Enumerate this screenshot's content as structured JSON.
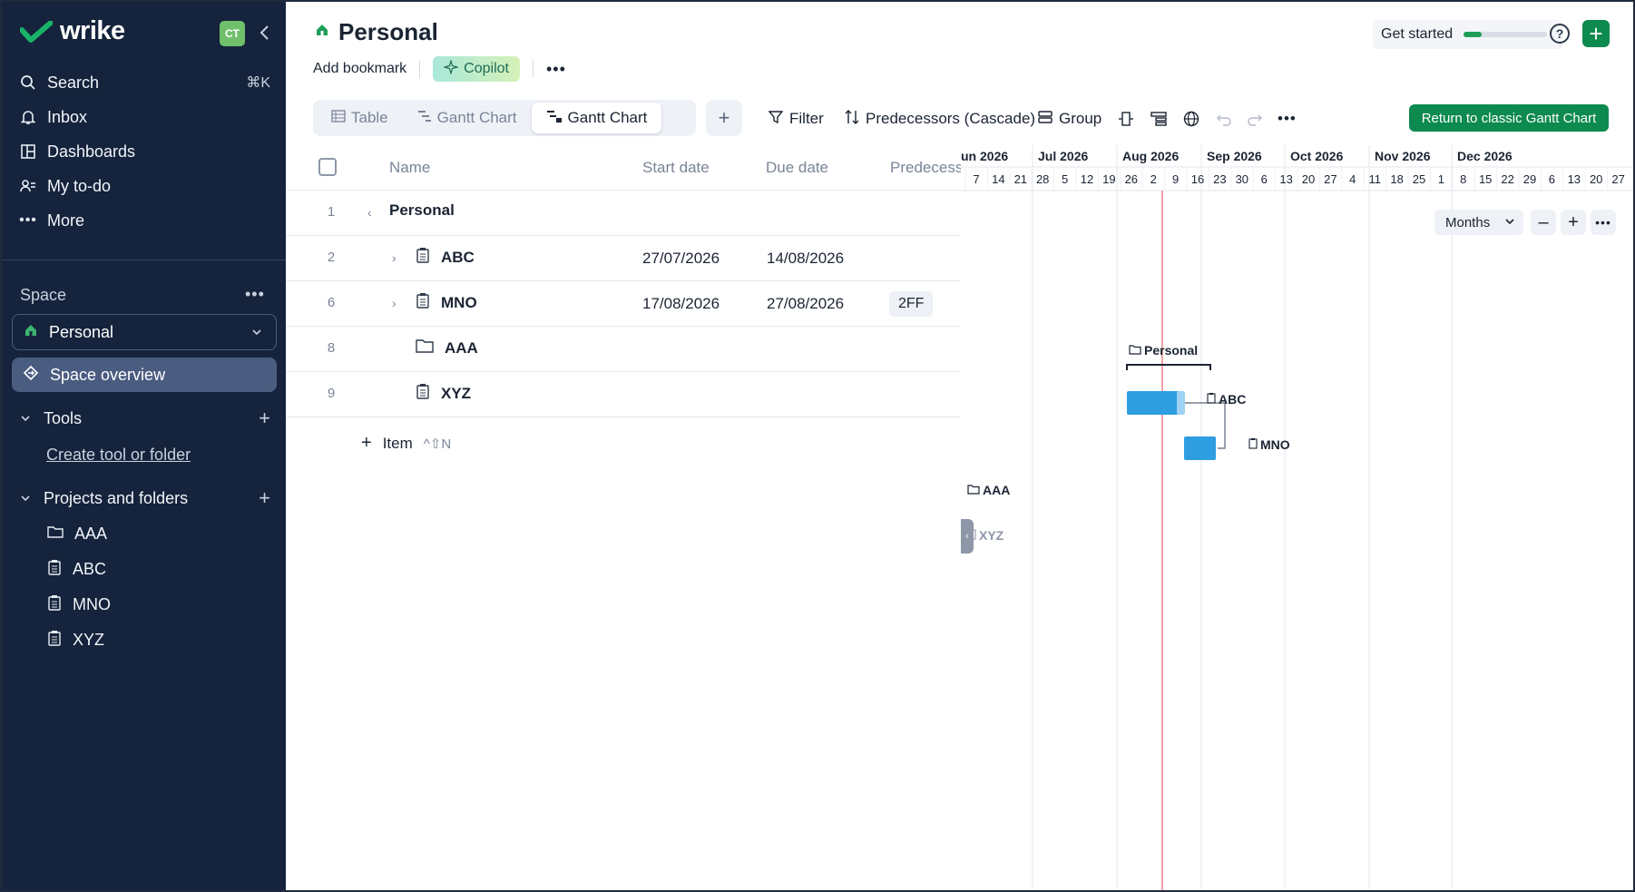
{
  "sidebar": {
    "brand": "wrike",
    "avatar_initials": "CT",
    "nav": [
      {
        "label": "Search",
        "icon": "search-icon",
        "shortcut": "⌘K"
      },
      {
        "label": "Inbox",
        "icon": "bell-icon"
      },
      {
        "label": "Dashboards",
        "icon": "dashboard-icon"
      },
      {
        "label": "My to-do",
        "icon": "person-list-icon"
      },
      {
        "label": "More",
        "icon": "more-icon"
      }
    ],
    "space_label": "Space",
    "space_selected": "Personal",
    "space_overview": "Space overview",
    "tools_label": "Tools",
    "create_link": "Create tool or folder",
    "projects_label": "Projects and folders",
    "tree": [
      {
        "label": "AAA",
        "icon": "folder-icon"
      },
      {
        "label": "ABC",
        "icon": "project-icon"
      },
      {
        "label": "MNO",
        "icon": "project-icon"
      },
      {
        "label": "XYZ",
        "icon": "project-icon"
      }
    ]
  },
  "header": {
    "title": "Personal",
    "add_bookmark": "Add bookmark",
    "copilot": "Copilot",
    "get_started": "Get started",
    "get_started_progress": 0.22,
    "help": "?"
  },
  "tabs": [
    {
      "label": "Table",
      "active": false
    },
    {
      "label": "Gantt Chart",
      "active": false
    },
    {
      "label": "Gantt Chart",
      "active": true
    }
  ],
  "toolbar": {
    "filter": "Filter",
    "predecessors": "Predecessors (Cascade)",
    "group": "Group",
    "classic_button": "Return to classic Gantt Chart"
  },
  "table": {
    "columns": [
      "Name",
      "Start date",
      "Due date",
      "Predecess"
    ],
    "rows": [
      {
        "num": "1",
        "name": "Personal",
        "start": "",
        "due": "",
        "pred": ""
      },
      {
        "num": "2",
        "name": "ABC",
        "start": "27/07/2026",
        "due": "14/08/2026",
        "pred": ""
      },
      {
        "num": "6",
        "name": "MNO",
        "start": "17/08/2026",
        "due": "27/08/2026",
        "pred": "2FF"
      },
      {
        "num": "8",
        "name": "AAA",
        "start": "",
        "due": "",
        "pred": ""
      },
      {
        "num": "9",
        "name": "XYZ",
        "start": "",
        "due": "",
        "pred": ""
      }
    ],
    "add_item": "Item",
    "add_item_shortcut": "^⇧N"
  },
  "gantt": {
    "months": [
      "un 2026",
      "Jul 2026",
      "Aug 2026",
      "Sep 2026",
      "Oct 2026",
      "Nov 2026",
      "Dec 2026"
    ],
    "days": [
      "7",
      "14",
      "21",
      "28",
      "5",
      "12",
      "19",
      "26",
      "2",
      "9",
      "16",
      "23",
      "30",
      "6",
      "13",
      "20",
      "27",
      "4",
      "11",
      "18",
      "25",
      "1",
      "8",
      "15",
      "22",
      "29",
      "6",
      "13",
      "20",
      "27"
    ],
    "scale": "Months",
    "labels": {
      "personal": "Personal",
      "abc": "ABC",
      "mno": "MNO",
      "aaa": "AAA",
      "xyz": "XYZ"
    },
    "colors": {
      "bar": "#2e9ee0",
      "today": "#e0464b",
      "accent": "#0d8a4f"
    }
  }
}
